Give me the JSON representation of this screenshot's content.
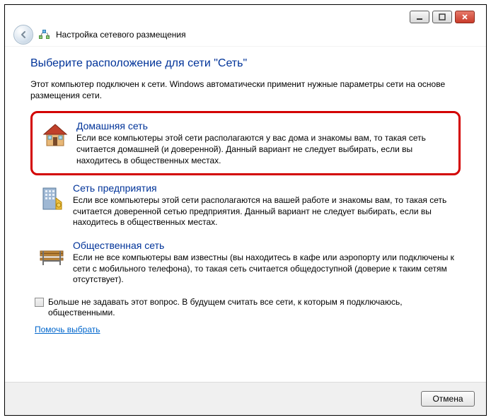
{
  "window": {
    "title": "Настройка сетевого размещения"
  },
  "heading": "Выберите расположение для сети \"Сеть\"",
  "intro": "Этот компьютер подключен к сети. Windows автоматически применит нужные параметры сети на основе размещения сети.",
  "options": [
    {
      "title": "Домашняя сеть",
      "desc": "Если все компьютеры этой сети располагаются у вас дома и знакомы вам, то такая сеть считается домашней (и доверенной). Данный вариант не следует выбирать, если вы находитесь в общественных местах."
    },
    {
      "title": "Сеть предприятия",
      "desc": "Если все компьютеры этой сети располагаются на вашей работе и знакомы вам, то такая сеть считается доверенной сетью предприятия. Данный вариант не следует выбирать, если вы находитесь в общественных местах."
    },
    {
      "title": "Общественная сеть",
      "desc": "Если не все компьютеры вам известны (вы находитесь в кафе или аэропорту или подключены к сети с мобильного телефона), то такая сеть считается общедоступной (доверие к таким сетям отсутствует)."
    }
  ],
  "checkbox_label": "Больше не задавать этот вопрос. В будущем считать все сети, к которым я подключаюсь, общественными.",
  "help_link": "Помочь выбрать",
  "cancel_label": "Отмена"
}
